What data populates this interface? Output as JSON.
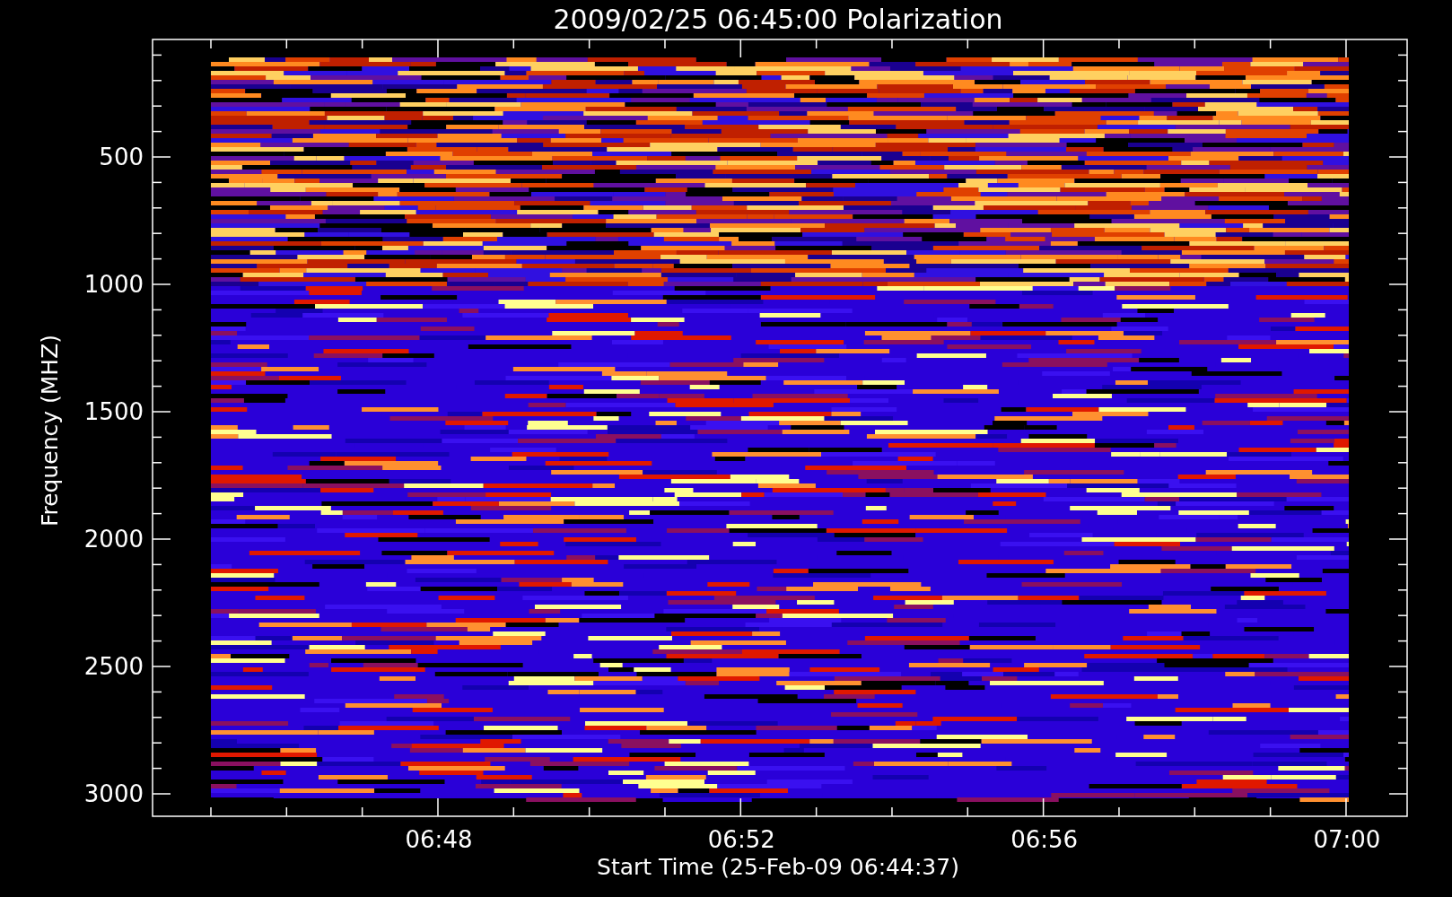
{
  "title": "2009/02/25 06:45:00 Polarization",
  "y_axis": {
    "label": "Frequency (MHZ)",
    "ticks": [
      "500",
      "1000",
      "1500",
      "2000",
      "2500",
      "3000"
    ]
  },
  "x_axis": {
    "label": "Start Time (25-Feb-09 06:44:37)",
    "ticks": [
      "06:48",
      "06:52",
      "06:56",
      "07:00"
    ]
  }
}
